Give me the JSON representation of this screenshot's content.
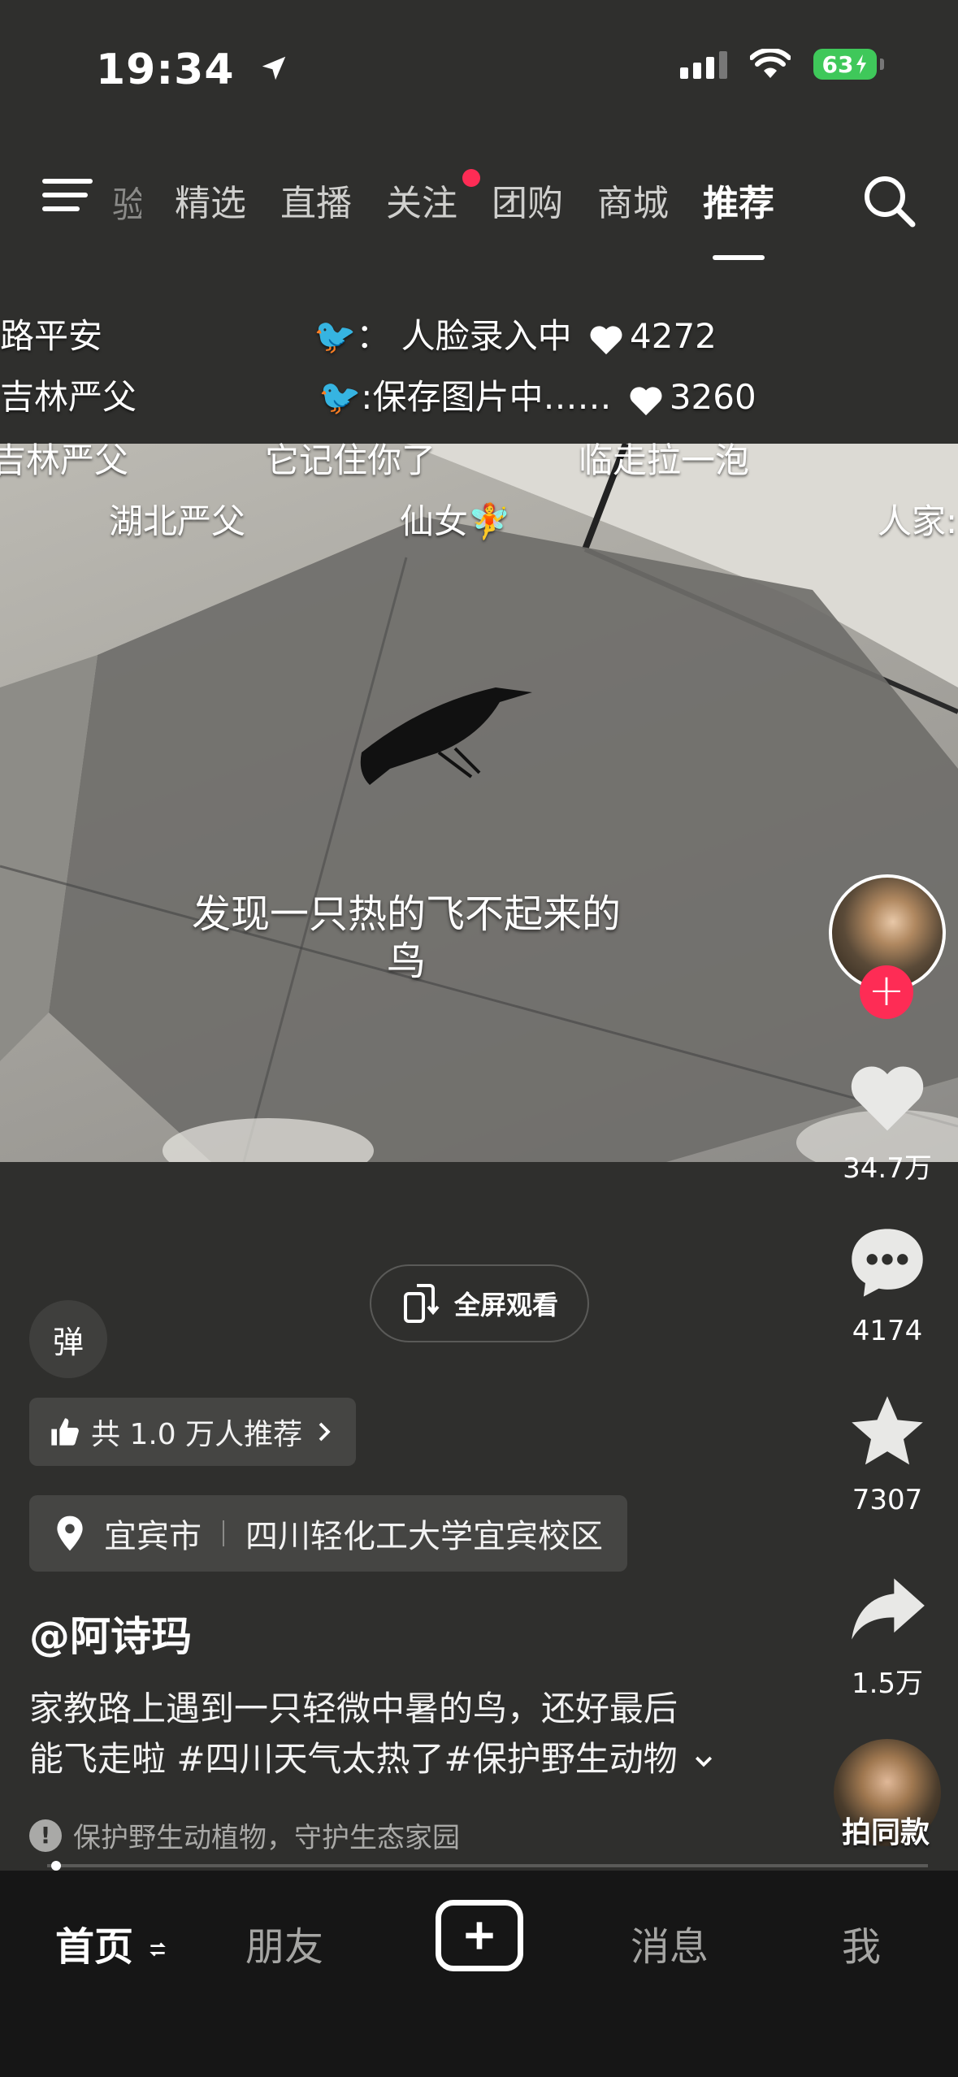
{
  "status_bar": {
    "time": "19:34",
    "battery": "63"
  },
  "top_nav": {
    "partial_tab": "验",
    "tabs": [
      {
        "label": "精选"
      },
      {
        "label": "直播"
      },
      {
        "label": "关注"
      },
      {
        "label": "团购"
      },
      {
        "label": "商城"
      },
      {
        "label": "推荐"
      }
    ]
  },
  "danmaku": {
    "row1": {
      "left": "路平安",
      "middle": "🐦：  人脸录入中",
      "likes": "4272"
    },
    "row2": {
      "left": "吉林严父",
      "middle": "🐦:保存图片中……",
      "likes": "3260"
    },
    "row3": [
      "吉林严父",
      "它记住你了",
      "临走拉一泡"
    ],
    "row4": [
      "湖北严父",
      "仙女🧚",
      "人家:"
    ]
  },
  "video": {
    "subtitle_line1": "发现一只热的飞不起来的",
    "subtitle_line2": "鸟"
  },
  "rail": {
    "likes": "34.7万",
    "comments": "4174",
    "favorites": "7307",
    "shares": "1.5万",
    "same_style": "拍同款"
  },
  "info": {
    "fullscreen": "全屏观看",
    "danmu_toggle": "弹",
    "recommend": "共 1.0 万人推荐",
    "city": "宜宾市",
    "place": "四川轻化工大学宜宾校区",
    "author": "@阿诗玛",
    "desc_line1": "家教路上遇到一只轻微中暑的鸟，还好最后",
    "desc_line2": "能飞走啦 #四川天气太热了#保护野生动物",
    "tip": "保护野生动植物，守护生态家园",
    "progress": 0.01
  },
  "tabbar": {
    "home": "首页",
    "friends": "朋友",
    "messages": "消息",
    "me": "我"
  }
}
